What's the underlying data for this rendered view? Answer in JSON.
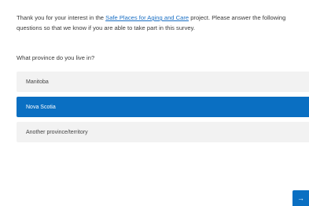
{
  "intro": {
    "before_link": "Thank you for your interest in the ",
    "link_text": "Safe Places for Aging and Care",
    "after_link": " project. Please answer the following questions so that we know if you are able to take part in this survey."
  },
  "question": "What province do you live in?",
  "choices": [
    {
      "label": "Manitoba",
      "selected": false
    },
    {
      "label": "Nova Scotia",
      "selected": true
    },
    {
      "label": "Another province/territory",
      "selected": false
    }
  ],
  "next_button": "→",
  "colors": {
    "accent": "#0a6fc2",
    "link": "#1a6fc4",
    "choice_bg": "#f2f2f2"
  }
}
